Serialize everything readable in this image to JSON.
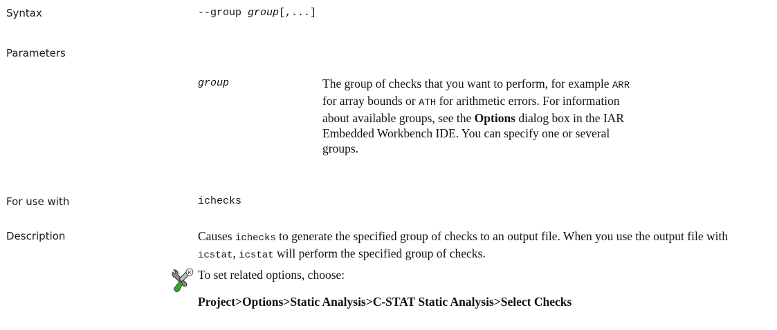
{
  "syntax": {
    "label": "Syntax",
    "option": "--group",
    "arg": "group",
    "rest": "[,...]"
  },
  "parameters": {
    "label": "Parameters",
    "name": "group",
    "desc_1": "The group of checks that you want to perform, for example",
    "code_arr": "ARR",
    "desc_2": "for array bounds or",
    "code_ath": "ATH",
    "desc_3": "for arithmetic errors. For information about available groups, see the",
    "options_bold": "Options",
    "desc_4": "dialog box in the IAR Embedded Workbench IDE. You can specify one or several groups."
  },
  "for_use_with": {
    "label": "For use with",
    "value": "ichecks"
  },
  "description": {
    "label": "Description",
    "t1": "Causes",
    "c1": "ichecks",
    "t2": "to generate the specified group of checks to an output file. When you use the output file with",
    "c2": "icstat",
    "t3": ",",
    "c3": "icstat",
    "t4": "will perform the specified group of checks."
  },
  "related": {
    "icon": "tools-icon",
    "intro": "To set related options, choose:",
    "path": "Project>Options>Static Analysis>C-STAT Static Analysis>Select Checks"
  }
}
